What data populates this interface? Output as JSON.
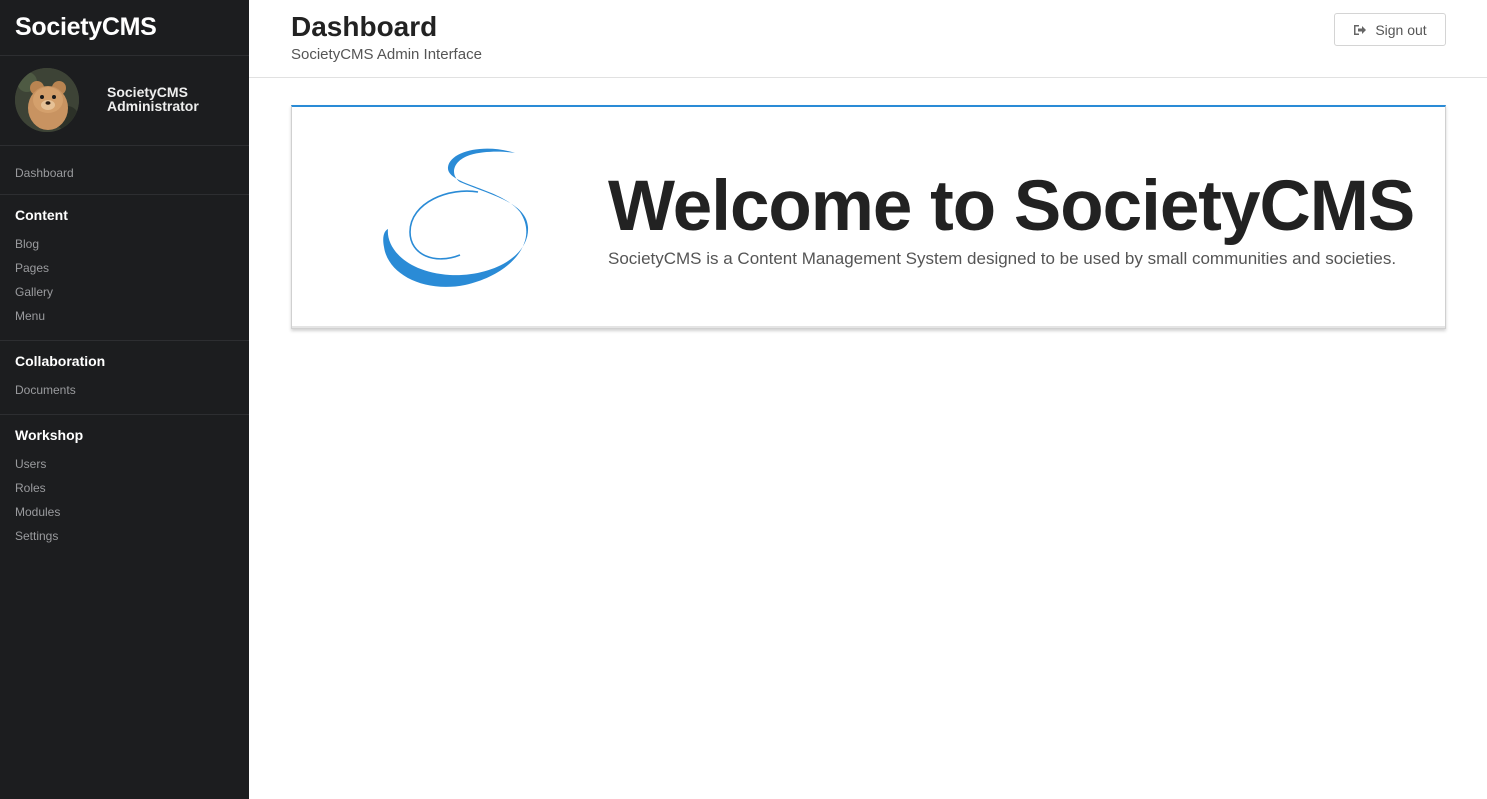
{
  "sidebar": {
    "brand": "SocietyCMS",
    "user": {
      "name": "SocietyCMS Administrator"
    },
    "dashboard": "Dashboard",
    "sections": [
      {
        "heading": "Content",
        "items": [
          "Blog",
          "Pages",
          "Gallery",
          "Menu"
        ]
      },
      {
        "heading": "Collaboration",
        "items": [
          "Documents"
        ]
      },
      {
        "heading": "Workshop",
        "items": [
          "Users",
          "Roles",
          "Modules",
          "Settings"
        ]
      }
    ]
  },
  "header": {
    "title": "Dashboard",
    "subtitle": "SocietyCMS Admin Interface",
    "signout_label": "Sign out",
    "signout_icon": "sign-out-icon"
  },
  "welcome": {
    "title": "Welcome to SocietyCMS",
    "text": "SocietyCMS is a Content Management System designed to be used by small communities and societies.",
    "accent": "#2a8bd6"
  }
}
